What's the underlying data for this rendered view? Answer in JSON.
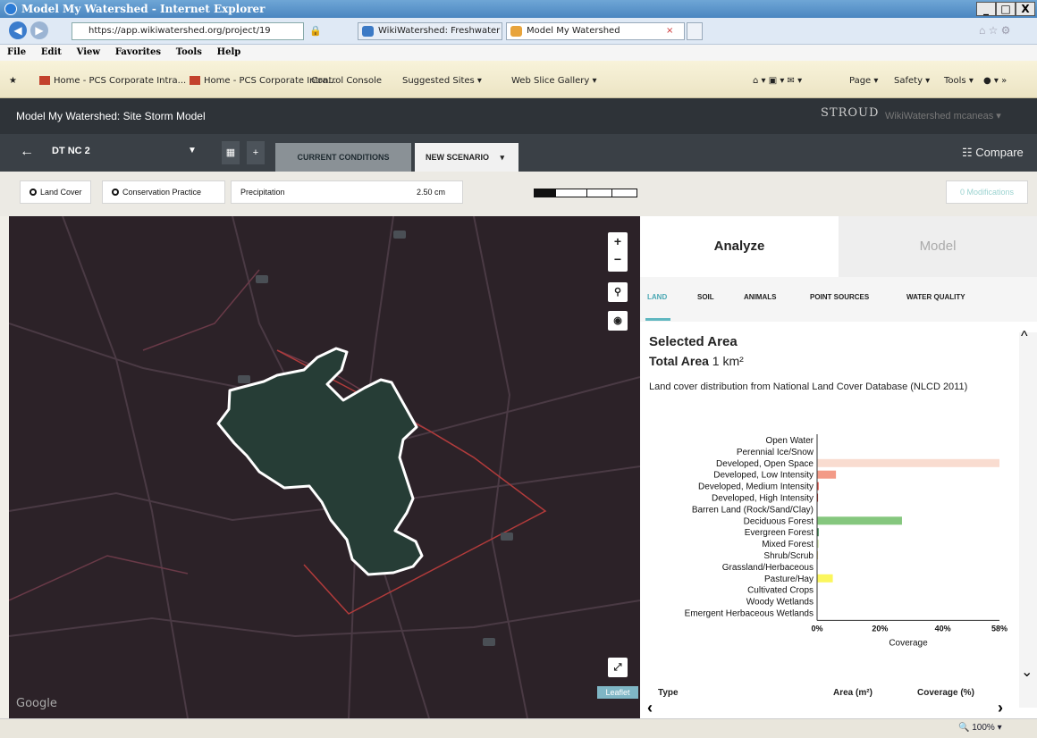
{
  "browser": {
    "window_title": "Model My Watershed - Internet Explorer",
    "url": "https://app.wikiwatershed.org/project/19",
    "tabs": [
      {
        "label": "WikiWatershed: Freshwater Sta...",
        "color": "#3c7ac5"
      },
      {
        "label": "Model My Watershed",
        "color": "#e8a43c"
      }
    ],
    "menu": [
      "File",
      "Edit",
      "View",
      "Favorites",
      "Tools",
      "Help"
    ],
    "favorites": [
      "Home - PCS Corporate Intra...",
      "Home - PCS Corporate Intra...",
      "Control Console",
      "Suggested Sites ▾",
      "Web Slice Gallery ▾"
    ],
    "command_bar": [
      "Page ▾",
      "Safety ▾",
      "Tools ▾"
    ],
    "window_buttons": [
      "_",
      "□",
      "X"
    ],
    "zoom": "100%"
  },
  "app": {
    "title": "Model My Watershed: Site Storm Model",
    "logo": "STROUD",
    "user_info": "WikiWatershed    mcaneas ▾",
    "project_name": "DT NC 2",
    "tabs": {
      "current": "CURRENT CONDITIONS",
      "new": "NEW SCENARIO"
    },
    "compare": "Compare",
    "toolbar": {
      "land_cover": "Land Cover",
      "conservation": "Conservation Practice",
      "precip_label": "Precipitation",
      "precip_value": "2.50 cm",
      "precip_fraction": 0.21,
      "modifications": "0 Modifications"
    }
  },
  "map": {
    "attribution": "Leaflet",
    "google": "Google"
  },
  "panel": {
    "tabs": {
      "analyze": "Analyze",
      "model": "Model"
    },
    "subtabs": [
      "LAND",
      "SOIL",
      "ANIMALS",
      "POINT SOURCES",
      "WATER QUALITY"
    ],
    "selected_area": "Selected Area",
    "total_area_label": "Total Area",
    "total_area_value": "1 km²",
    "description": "Land cover distribution from National Land Cover Database (NLCD 2011)",
    "table": {
      "col_type": "Type",
      "col_area": "Area (m²)",
      "col_coverage": "Coverage (%)"
    }
  },
  "chart_data": {
    "type": "bar",
    "orientation": "horizontal",
    "categories": [
      "Open Water",
      "Perennial Ice/Snow",
      "Developed, Open Space",
      "Developed, Low Intensity",
      "Developed, Medium Intensity",
      "Developed, High Intensity",
      "Barren Land (Rock/Sand/Clay)",
      "Deciduous Forest",
      "Evergreen Forest",
      "Mixed Forest",
      "Shrub/Scrub",
      "Grassland/Herbaceous",
      "Pasture/Hay",
      "Cultivated Crops",
      "Woody Wetlands",
      "Emergent Herbaceous Wetlands"
    ],
    "values": [
      0,
      0,
      58,
      6,
      0.5,
      0.3,
      0,
      27,
      0.5,
      0.5,
      0.3,
      0,
      5,
      0,
      0,
      0
    ],
    "colors": [
      "#5475a8",
      "#ffffff",
      "#f9dcd0",
      "#f39a87",
      "#e2544a",
      "#b12a20",
      "#d2cdc0",
      "#85c77e",
      "#38814e",
      "#d4e7b0",
      "#dcca8f",
      "#fde9aa",
      "#fbf65d",
      "#ca9146",
      "#c8e6f8",
      "#64b3d5"
    ],
    "xlabel": "Coverage",
    "ticks": [
      "0%",
      "20%",
      "40%",
      "58%"
    ],
    "xlim": [
      0,
      58
    ]
  }
}
